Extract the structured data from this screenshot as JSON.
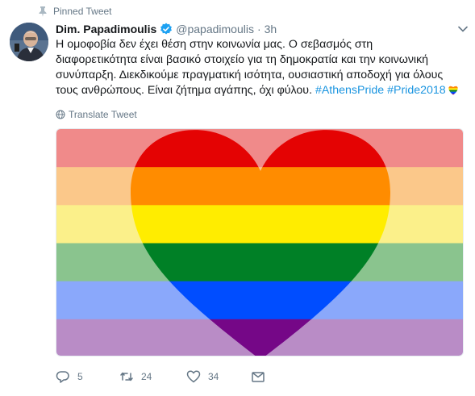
{
  "pinned": {
    "label": "Pinned Tweet",
    "icon": "pin-icon"
  },
  "author": {
    "name": "Dim. Papadimoulis",
    "handle": "@papadimoulis",
    "separator": "·",
    "time": "3h",
    "verified": true,
    "verified_color": "#1da1f2",
    "avatar_icon": "avatar-photo"
  },
  "tweet": {
    "lines": [
      "Η ομοφοβία δεν έχει θέση στην κοινωνία μας. Ο σεβασμός στη",
      "διαφορετικότητα είναι βασικό στοιχείο για τη δημοκρατία και την κοινωνική",
      "συνύπαρξη. Διεκδικούμε πραγματική ισότητα, ουσιαστική αποδοχή για όλους"
    ],
    "last_line_text": "τους ανθρώπους. Είναι ζήτημα αγάπης, όχι φύλου. ",
    "hashtags": [
      "#AthensPride",
      "#Pride2018"
    ],
    "hashtag_color": "#1b95e0"
  },
  "translate": {
    "label": "Translate Tweet",
    "icon": "globe-icon"
  },
  "media": {
    "description_icon": "rainbow-heart-image",
    "stripe_colors": [
      "#f08a8a",
      "#fbc88a",
      "#fbf08a",
      "#8ac48e",
      "#8aa8fb",
      "#b98cc6"
    ],
    "heart_colors": [
      "#e40303",
      "#ff8c00",
      "#ffed00",
      "#008026",
      "#004dff",
      "#750787"
    ]
  },
  "actions": {
    "reply": {
      "icon": "reply-icon",
      "count": "5"
    },
    "retweet": {
      "icon": "retweet-icon",
      "count": "24"
    },
    "like": {
      "icon": "heart-icon",
      "count": "34"
    },
    "message": {
      "icon": "envelope-icon"
    }
  },
  "colors": {
    "muted": "#657786",
    "text": "#14171a"
  }
}
